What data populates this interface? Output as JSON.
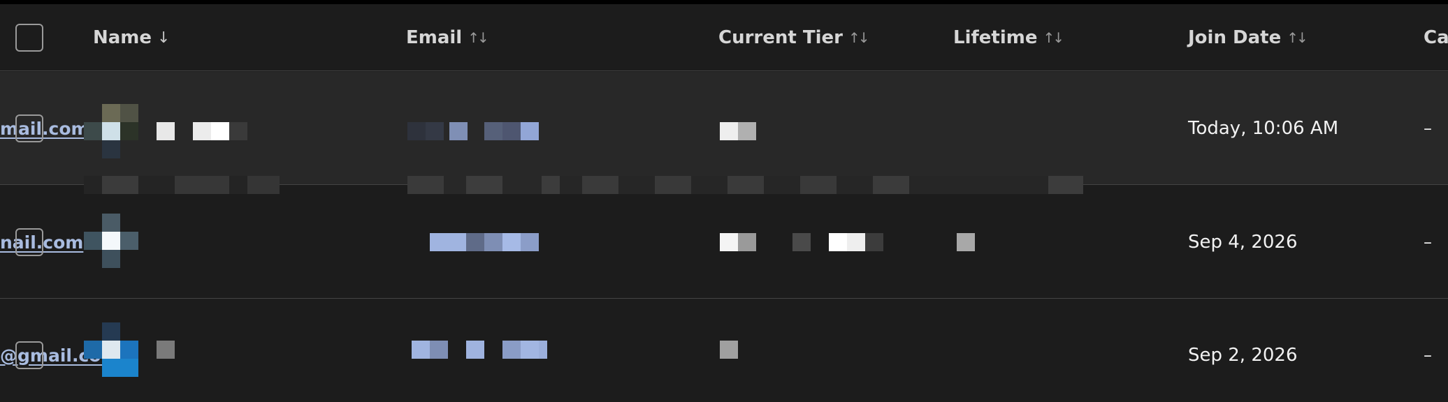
{
  "columns": {
    "select_all": "",
    "name": "Name",
    "email": "Email",
    "current_tier": "Current Tier",
    "lifetime": "Lifetime",
    "join_date": "Join Date",
    "cancel": "Ca"
  },
  "rows": [
    {
      "email_visible": "mail.com",
      "join_date": "Today, 10:06 AM",
      "last": "–"
    },
    {
      "email_visible": "nail.com",
      "join_date": "Sep 4, 2026",
      "last": "–"
    },
    {
      "email_visible": "@gmail.com",
      "join_date": "Sep 2, 2026",
      "last": "–"
    }
  ],
  "icons": {
    "sort_desc": "arrow-down-icon",
    "sort_both": "sort-updown-icon"
  },
  "colors": {
    "background": "#1c1c1c",
    "row_hover": "#282828",
    "link": "#a9bce0",
    "header_text": "#d6d6d6"
  }
}
